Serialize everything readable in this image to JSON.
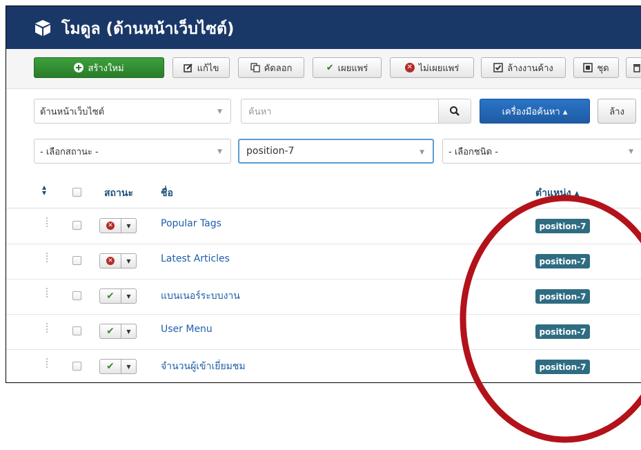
{
  "header": {
    "title": "โมดูล (ด้านหน้าเว็บไซต์)",
    "icon": "cube-icon"
  },
  "toolbar": {
    "new_label": "สร้างใหม่",
    "edit_label": "แก้ไข",
    "copy_label": "คัดลอก",
    "publish_label": "เผยแพร่",
    "unpublish_label": "ไม่เผยแพร่",
    "checkin_label": "ล้างงานค้าง",
    "batch_label": "ชุด"
  },
  "filters": {
    "client": "ด้านหน้าเว็บไซต์",
    "search_placeholder": "ค้นหา",
    "search_tools_label": "เครื่องมือค้นหา ▴",
    "clear_label": "ล้าง",
    "state": "- เลือกสถานะ -",
    "position": "position-7",
    "type": "- เลือกชนิด -"
  },
  "table": {
    "columns": {
      "status": "สถานะ",
      "title": "ชื่อ",
      "position": "ตำแหน่ง ▴"
    },
    "rows": [
      {
        "status": "unpublished",
        "title": "Popular Tags",
        "position": "position-7"
      },
      {
        "status": "unpublished",
        "title": "Latest Articles",
        "position": "position-7"
      },
      {
        "status": "published",
        "title": "แบนเนอร์ระบบงาน",
        "position": "position-7"
      },
      {
        "status": "published",
        "title": "User Menu",
        "position": "position-7"
      },
      {
        "status": "published",
        "title": "จำนวนผู้เข้าเยี่ยมชม",
        "position": "position-7"
      }
    ]
  },
  "colors": {
    "header_bg": "#1a3867",
    "green": "#2a7c2a",
    "accent": "#1e5ca3",
    "badge": "#2f6c82",
    "annotation": "#b3121a"
  }
}
